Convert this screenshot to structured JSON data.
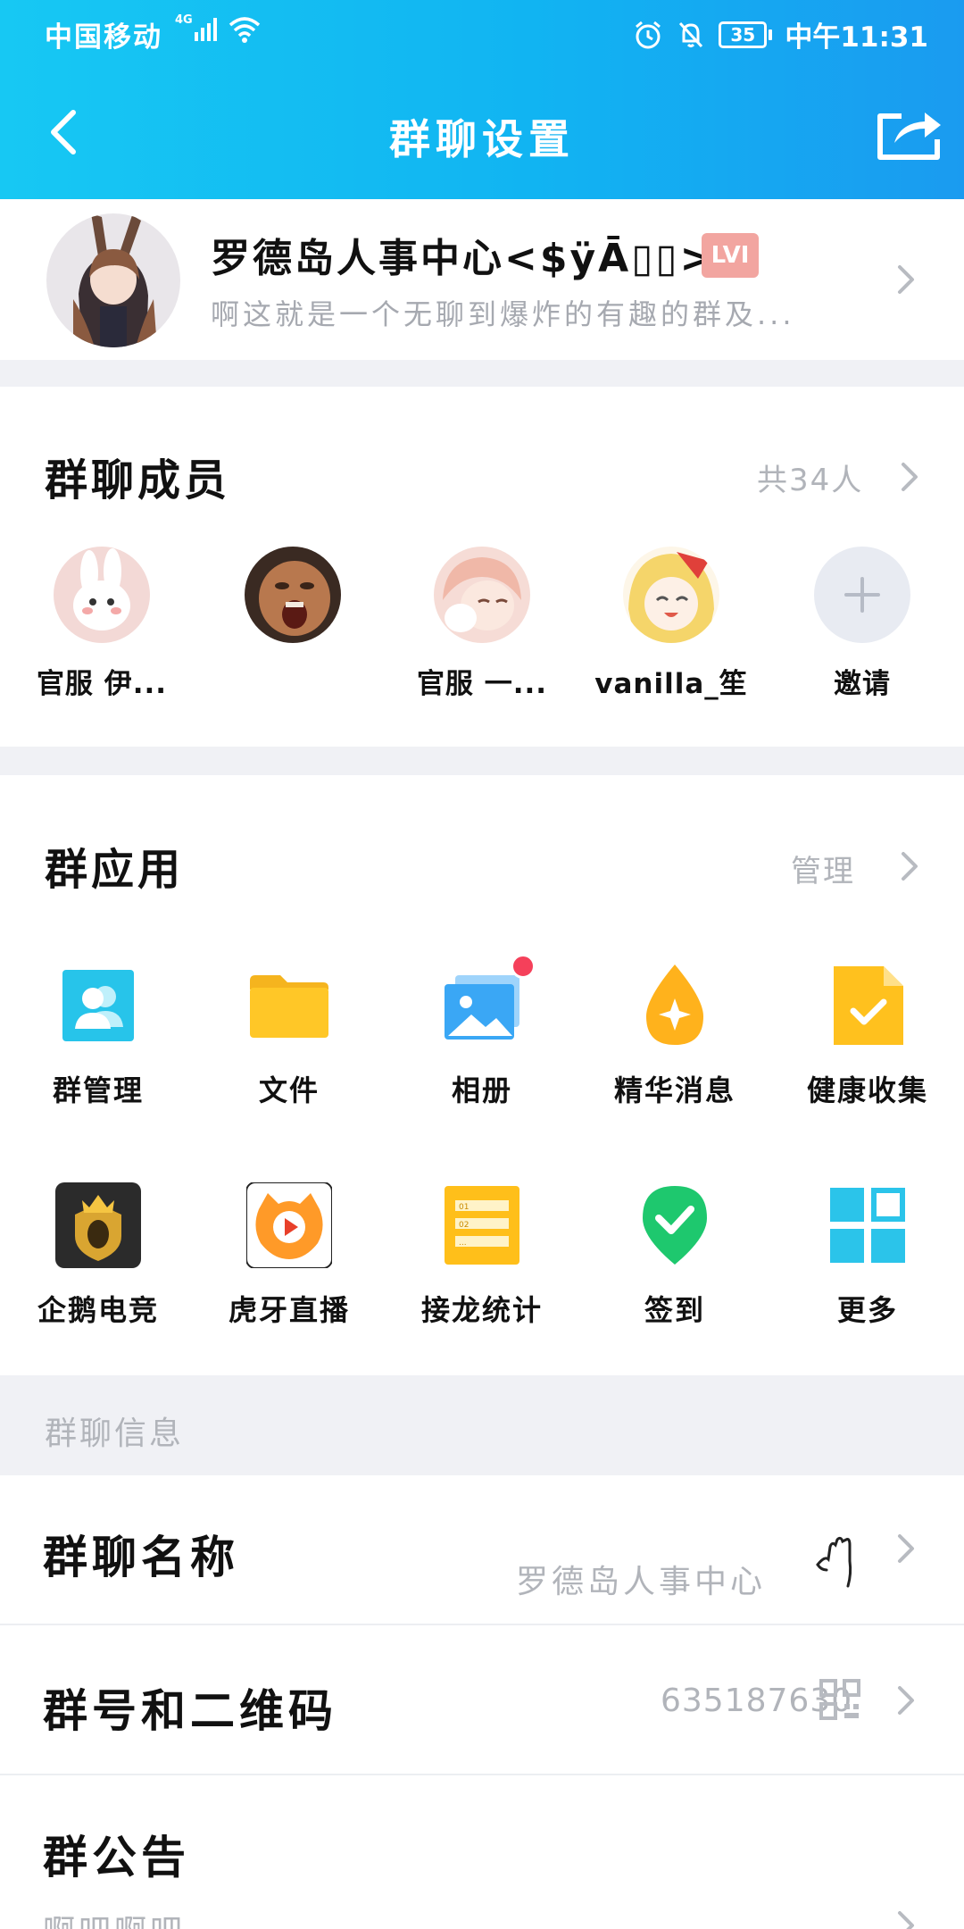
{
  "status_bar": {
    "carrier": "中国移动",
    "network": "4G",
    "battery": "35",
    "time": "中午11:31"
  },
  "nav": {
    "title": "群聊设置"
  },
  "group": {
    "name": "罗德岛人事中心<$ÿĀ▯▯>",
    "level": "LVI",
    "description": "啊这就是一个无聊到爆炸的有趣的群及..."
  },
  "members_section": {
    "title": "群聊成员",
    "count": "共34人",
    "members": [
      {
        "name": "官服 伊..."
      },
      {
        "name": ""
      },
      {
        "name": "官服 一..."
      },
      {
        "name": "vanilla_笙"
      },
      {
        "name": "邀请"
      }
    ]
  },
  "apps_section": {
    "title": "群应用",
    "manage": "管理",
    "apps": [
      {
        "label": "群管理",
        "icon": "group-manage-icon",
        "color": "#27c4ea"
      },
      {
        "label": "文件",
        "icon": "folder-icon",
        "color": "#ffc727"
      },
      {
        "label": "相册",
        "icon": "photo-album-icon",
        "color": "#3aa7f5"
      },
      {
        "label": "精华消息",
        "icon": "essence-drop-icon",
        "color": "#ffb21c"
      },
      {
        "label": "健康收集",
        "icon": "health-doc-icon",
        "color": "#ffc11e"
      },
      {
        "label": "企鹅电竞",
        "icon": "esports-icon",
        "color": "#2b2b2b"
      },
      {
        "label": "虎牙直播",
        "icon": "huya-icon",
        "color": "#ff9a28"
      },
      {
        "label": "接龙统计",
        "icon": "relay-stats-icon",
        "color": "#ffbf1a"
      },
      {
        "label": "签到",
        "icon": "checkin-icon",
        "color": "#1ec86e"
      },
      {
        "label": "更多",
        "icon": "more-grid-icon",
        "color": "#2bc4ea"
      }
    ]
  },
  "info_section": {
    "title": "群聊信息",
    "name_row": {
      "label": "群聊名称",
      "value": "罗德岛人事中心"
    },
    "number_row": {
      "label": "群号和二维码",
      "value": "635187630"
    },
    "notice_row": {
      "label": "群公告",
      "value": "啊吧啊吧"
    }
  },
  "colors": {
    "header_start": "#17c8f3",
    "header_end": "#1a9bf0",
    "muted_text": "#b1b4ba",
    "badge": "#f2a5a0",
    "notification_dot": "#f5405a"
  }
}
